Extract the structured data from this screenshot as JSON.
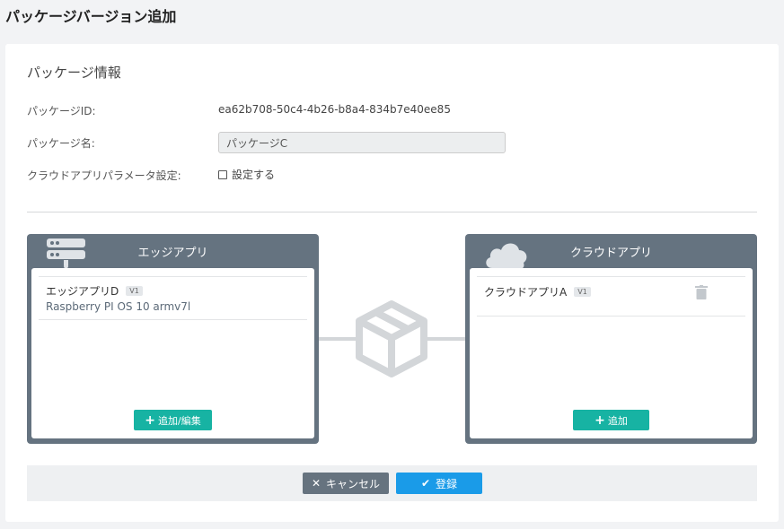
{
  "header": {
    "title": "パッケージバージョン追加"
  },
  "package_info": {
    "section_title": "パッケージ情報",
    "id_label": "パッケージID:",
    "id_value": "ea62b708-50c4-4b26-b8a4-834b7e40ee85",
    "name_label": "パッケージ名:",
    "name_value": "パッケージC",
    "cloud_param_label": "クラウドアプリパラメータ設定:",
    "cloud_param_checkbox": "設定する",
    "cloud_param_checked": false
  },
  "edge_panel": {
    "title": "エッジアプリ",
    "icon": "server-icon",
    "items": [
      {
        "name": "エッジアプリD",
        "version": "V1",
        "os": "Raspberry PI OS 10 armv7l"
      }
    ],
    "add_button": "追加/編集"
  },
  "cloud_panel": {
    "title": "クラウドアプリ",
    "icon": "cloud-icon",
    "items": [
      {
        "name": "クラウドアプリA",
        "version": "V1"
      }
    ],
    "add_button": "追加"
  },
  "center_icon": "package-box-icon",
  "footer": {
    "cancel_label": "キャンセル",
    "save_label": "登録"
  },
  "colors": {
    "panel_header": "#657380",
    "add_button": "#17b3a3",
    "cancel_button": "#66737f",
    "save_button": "#1a9be8"
  }
}
